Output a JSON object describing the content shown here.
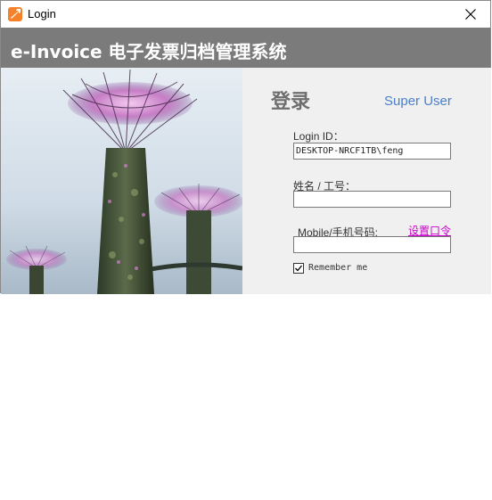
{
  "window": {
    "title": "Login"
  },
  "header": {
    "title": "e-Invoice 电子发票归档管理系统"
  },
  "login": {
    "title": "登录",
    "super_user_link": "Super User",
    "login_id_label": "Login ID：",
    "login_id_value": "DESKTOP-NRCF1TB\\feng",
    "name_label": "姓名 / 工号：",
    "name_value": "",
    "mobile_label": "Mobile/手机号码:",
    "mobile_value": "",
    "set_password_link": "设置口令",
    "remember_label": "Remember me",
    "remember_checked": true
  },
  "colors": {
    "header_bg": "#7b7b7b",
    "link_blue": "#4a7fd0",
    "link_magenta": "#cc00cc",
    "panel_bg": "#f0f0f0"
  }
}
